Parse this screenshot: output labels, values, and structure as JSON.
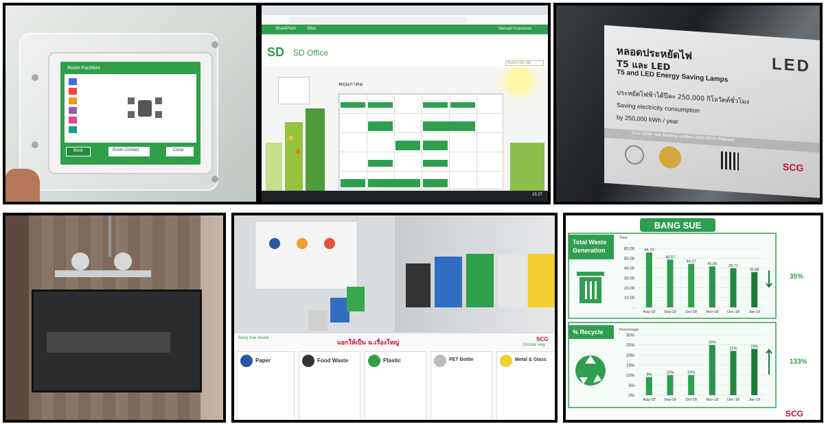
{
  "tablet": {
    "title": "Room Facilities",
    "buttons": [
      "Book",
      "Room Contact",
      "Close"
    ]
  },
  "sharepoint": {
    "nav_left": "SharePoint",
    "nav_sites": "Sites",
    "site_logo": "SD",
    "site_title": "SD Office",
    "calendar_heading": "พฤษภาคม",
    "user_name": "Wanrapit Poopnamon",
    "search_placeholder": "Search this site",
    "taskbar_time": "15:27"
  },
  "sign": {
    "line1": "หลอดประหยัดไฟ",
    "line2": "T5 และ LED",
    "line3": "T5 and LED Energy Saving Lamps",
    "thai_saving": "ประหยัดไฟฟ้าได้ปีละ 250,000 กิโลวัตต์ชั่วโมง",
    "en_saving_1": "Saving electricity consumption",
    "en_saving_2": "by 250,000 kWh / year",
    "logo_led": "LED",
    "footer": "SCG 100th Year Building certified LEED BD+C Platinum",
    "brand": "SCG"
  },
  "bins": {
    "poster_title": "Bang Sue Model",
    "poster_brand": "SCG",
    "poster_brand_sub": "Circular way",
    "headline": "แยกให้เป็น ฉ.เรื่องใหญ่",
    "categories": [
      "Paper",
      "Food Waste",
      "Plastic",
      "PET Bottle",
      "Metal & Glass"
    ]
  },
  "chart_header": "BANG SUE",
  "brand_footer": "SCG",
  "icons": {
    "trash": "trash-bin-icon",
    "recycle": "recycle-icon"
  },
  "colors": {
    "green": "#2e9e4f",
    "dark_green": "#1e7a3a",
    "scg_red": "#c8102e"
  },
  "chart_data": [
    {
      "type": "bar",
      "title": "Total Waste Generation",
      "ylabel": "Tons",
      "categories": [
        "Aug-18",
        "Sep-18",
        "Oct-18",
        "Nov-18",
        "Dec-18",
        "Jan-19"
      ],
      "values": [
        55.73,
        48.57,
        44.27,
        41.69,
        39.71,
        35.88
      ],
      "labels": [
        "55.73",
        "48.57",
        "44.27",
        "41.69",
        "39.71",
        "35.88"
      ],
      "ylim": [
        0,
        60
      ],
      "yticks": [
        "60.00",
        "50.00",
        "40.00",
        "30.00",
        "20.00",
        "10.00",
        "-"
      ],
      "change": "35%",
      "trend": "down"
    },
    {
      "type": "bar",
      "title": "% Recycle",
      "ylabel": "Percentage",
      "categories": [
        "Aug-18",
        "Sep-18",
        "Oct-18",
        "Nov-18",
        "Dec-18",
        "Jan-19"
      ],
      "values": [
        9,
        10,
        10,
        25,
        22,
        23
      ],
      "labels": [
        "9%",
        "10%",
        "10%",
        "25%",
        "22%",
        "23%"
      ],
      "ylim": [
        0,
        30
      ],
      "yticks": [
        "30%",
        "25%",
        "20%",
        "15%",
        "10%",
        "5%",
        "0%"
      ],
      "change": "133%",
      "trend": "up"
    }
  ]
}
